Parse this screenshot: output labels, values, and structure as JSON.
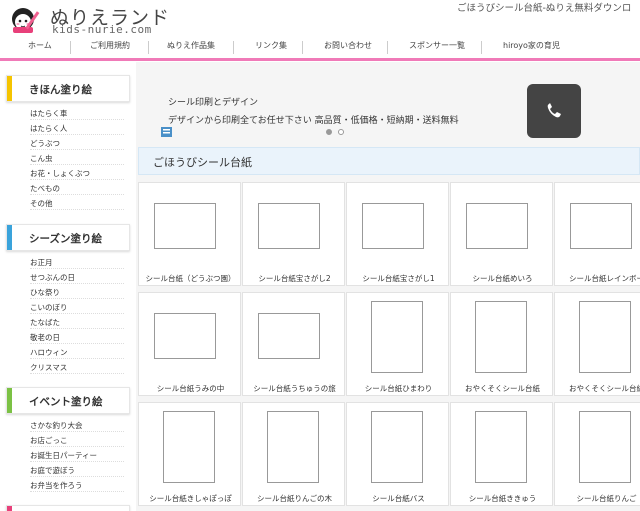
{
  "header": {
    "logo_title": "ぬりえランド",
    "logo_sub": "kids-nurie.com",
    "tagline": "ごほうびシール台紙-ぬりえ無料ダウンロ"
  },
  "nav": {
    "items": [
      "ホーム",
      "ご利用規約",
      "ぬりえ作品集",
      "リンク集",
      "お問い合わせ",
      "スポンサー一覧",
      "hiroyo家の育児"
    ]
  },
  "sidebar": {
    "sections": [
      {
        "title": "きほん塗り絵",
        "color": "#f5c400",
        "items": [
          "はたらく車",
          "はたらく人",
          "どうぶつ",
          "こん虫",
          "お花・しょくぶつ",
          "たべもの",
          "その他"
        ]
      },
      {
        "title": "シーズン塗り絵",
        "color": "#3aa3db",
        "items": [
          "お正月",
          "せつぶんの日",
          "ひな祭り",
          "こいのぼり",
          "たなばた",
          "敬老の日",
          "ハロウィン",
          "クリスマス"
        ]
      },
      {
        "title": "イベント塗り絵",
        "color": "#7bc144",
        "items": [
          "さかな釣り大会",
          "お店ごっこ",
          "お誕生日パーティー",
          "お庭で遊ぼう",
          "お弁当を作ろう"
        ]
      }
    ]
  },
  "slider": {
    "title": "シール印刷とデザイン",
    "text": "デザインから印刷全てお任せ下さい 高品質・低価格・短納期・送料無料"
  },
  "section": {
    "title": "ごほうびシール台紙"
  },
  "cards": [
    [
      "シール台紙（どうぶつ園）",
      "シール台紙宝さがし2",
      "シール台紙宝さがし1",
      "シール台紙めいろ",
      "シール台紙レインボー"
    ],
    [
      "シール台紙うみの中",
      "シール台紙うちゅうの旅",
      "シール台紙ひまわり",
      "おやくそくシール台紙",
      "おやくそくシール台紙"
    ],
    [
      "シール台紙きしゃぽっぽ",
      "シール台紙りんごの木",
      "シール台紙バス",
      "シール台紙ききゅう",
      "シール台紙りんご"
    ]
  ],
  "colors": {
    "nav_underline": "#f07ab8",
    "section_bg": "#eaf3fb",
    "phone_bg": "#444444"
  },
  "icons": {
    "phone": "phone-icon",
    "logo": "girl-with-pencil-logo"
  }
}
